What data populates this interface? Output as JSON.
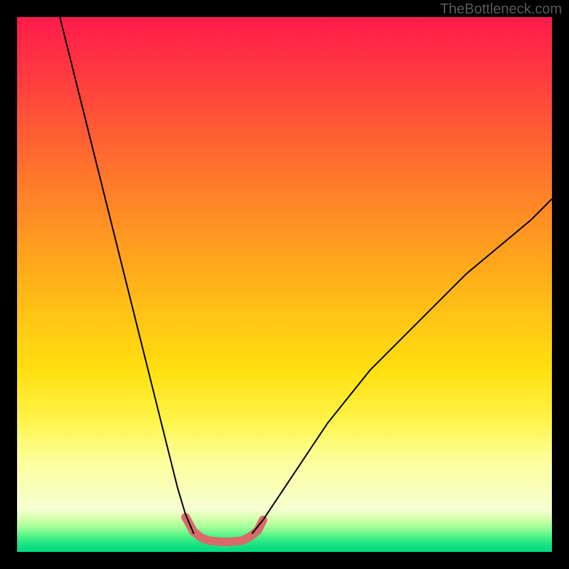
{
  "watermark": "TheBottleneck.com",
  "chart_data": {
    "type": "line",
    "title": "",
    "xlabel": "",
    "ylabel": "",
    "xlim": [
      0,
      100
    ],
    "ylim": [
      0,
      100
    ],
    "grid": false,
    "legend": false,
    "description": "Bottleneck curve: two black branches descending into a rounded pink valley near the bottom over a vertical rainbow gradient (red top → green bottom).",
    "series": [
      {
        "name": "left-branch",
        "color": "#000000",
        "stroke_width": 2,
        "x": [
          8,
          10,
          12,
          14,
          16,
          18,
          20,
          22,
          24,
          26,
          28,
          30,
          31.5,
          33
        ],
        "y": [
          100,
          92,
          84,
          76,
          68,
          60,
          52,
          44,
          36,
          28,
          20,
          12,
          7,
          3.5
        ]
      },
      {
        "name": "right-branch",
        "color": "#000000",
        "stroke_width": 2,
        "x": [
          44,
          46,
          50,
          54,
          58,
          62,
          66,
          72,
          78,
          84,
          90,
          96,
          100
        ],
        "y": [
          3.5,
          6,
          12,
          18,
          24,
          29,
          34,
          40,
          46,
          52,
          57,
          62,
          66
        ]
      },
      {
        "name": "valley-band",
        "color": "#d96a6a",
        "stroke_width": 12,
        "x": [
          31.5,
          33,
          34.5,
          36,
          38,
          40,
          42,
          43.5,
          45,
          46
        ],
        "y": [
          6.5,
          3.8,
          2.6,
          2.1,
          1.9,
          1.9,
          2.1,
          2.8,
          4.0,
          6.0
        ]
      }
    ]
  }
}
